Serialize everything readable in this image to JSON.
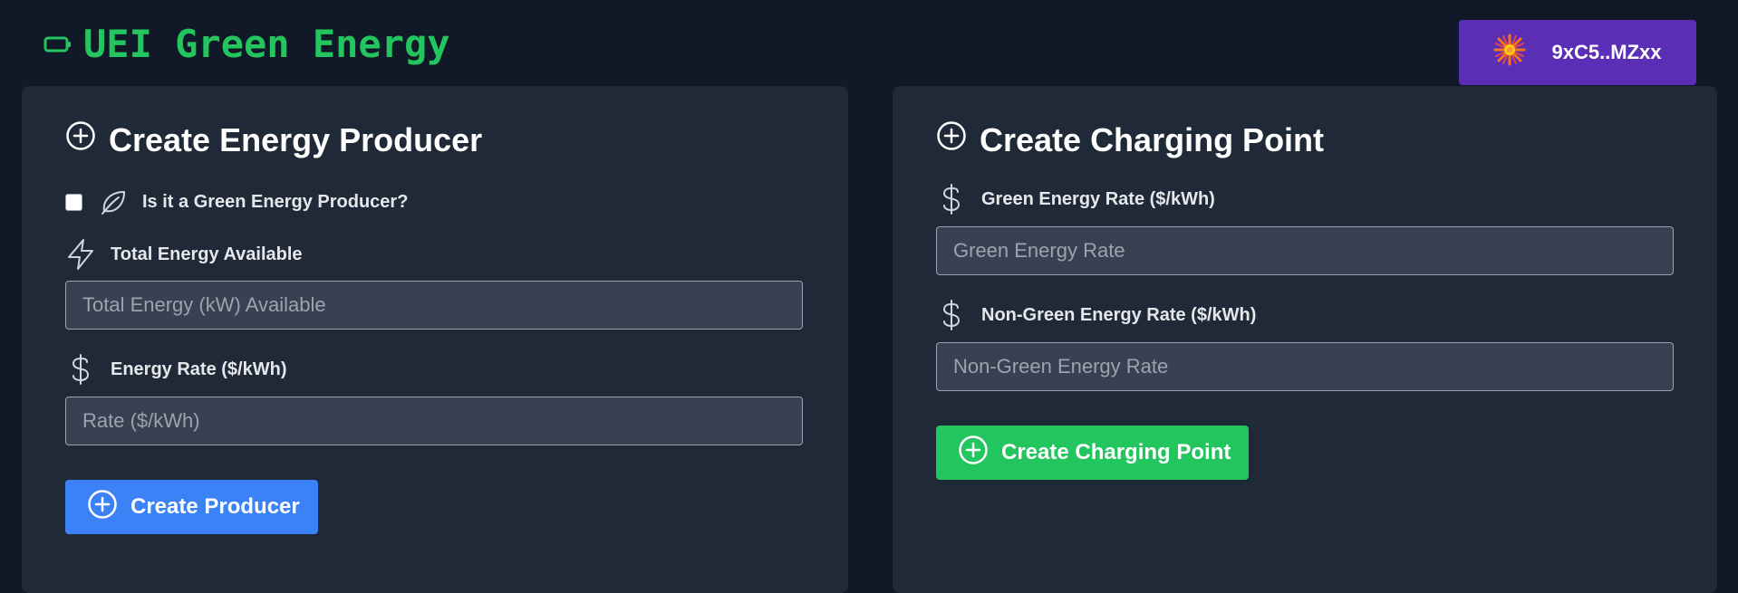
{
  "header": {
    "title": "UEI Green Energy",
    "logo_icon": "battery-icon",
    "accent_color": "#22c55e"
  },
  "wallet": {
    "label": "9xC5..MZxx",
    "icon": "sparkle-burst-icon",
    "color": "#5b2fb5"
  },
  "producer_panel": {
    "title": "Create Energy Producer",
    "green_checkbox_label": "Is it a Green Energy Producer?",
    "green_checked": false,
    "total_energy_label": "Total Energy Available",
    "total_energy_placeholder": "Total Energy (kW) Available",
    "total_energy_value": "",
    "rate_label": "Energy Rate ($/kWh)",
    "rate_placeholder": "Rate ($/kWh)",
    "rate_value": "",
    "submit_label": "Create Producer",
    "submit_color": "#3b82f6"
  },
  "charging_panel": {
    "title": "Create Charging Point",
    "green_rate_label": "Green Energy Rate ($/kWh)",
    "green_rate_placeholder": "Green Energy Rate",
    "green_rate_value": "",
    "nongreen_rate_label": "Non-Green Energy Rate ($/kWh)",
    "nongreen_rate_placeholder": "Non-Green Energy Rate",
    "nongreen_rate_value": "",
    "submit_label": "Create Charging Point",
    "submit_color": "#22c55e"
  }
}
